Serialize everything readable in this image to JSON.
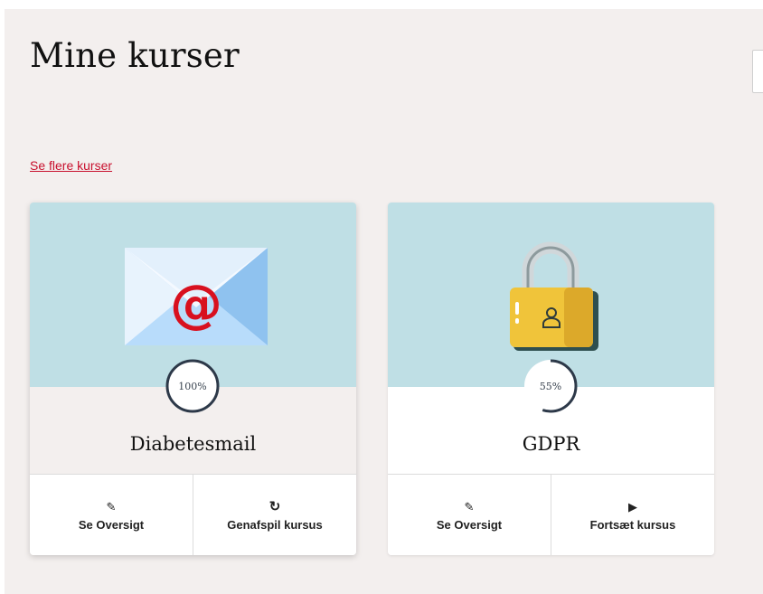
{
  "page": {
    "title": "Mine kurser",
    "more_link": "Se flere kurser"
  },
  "colors": {
    "accent": "#c8102e",
    "card_image_bg": "#bfdfe5",
    "progress_ring": "#2d3949"
  },
  "courses": [
    {
      "name": "Diabetesmail",
      "progress_label": "100%",
      "progress_fraction": 1.0,
      "image_icon": "email-envelope-icon",
      "actions": [
        {
          "icon": "edit-icon",
          "label": "Se Oversigt"
        },
        {
          "icon": "replay-icon",
          "label": "Genafspil kursus"
        }
      ]
    },
    {
      "name": "GDPR",
      "progress_label": "55%",
      "progress_fraction": 0.55,
      "image_icon": "padlock-icon",
      "actions": [
        {
          "icon": "edit-icon",
          "label": "Se Oversigt"
        },
        {
          "icon": "play-icon",
          "label": "Fortsæt kursus"
        }
      ]
    }
  ]
}
